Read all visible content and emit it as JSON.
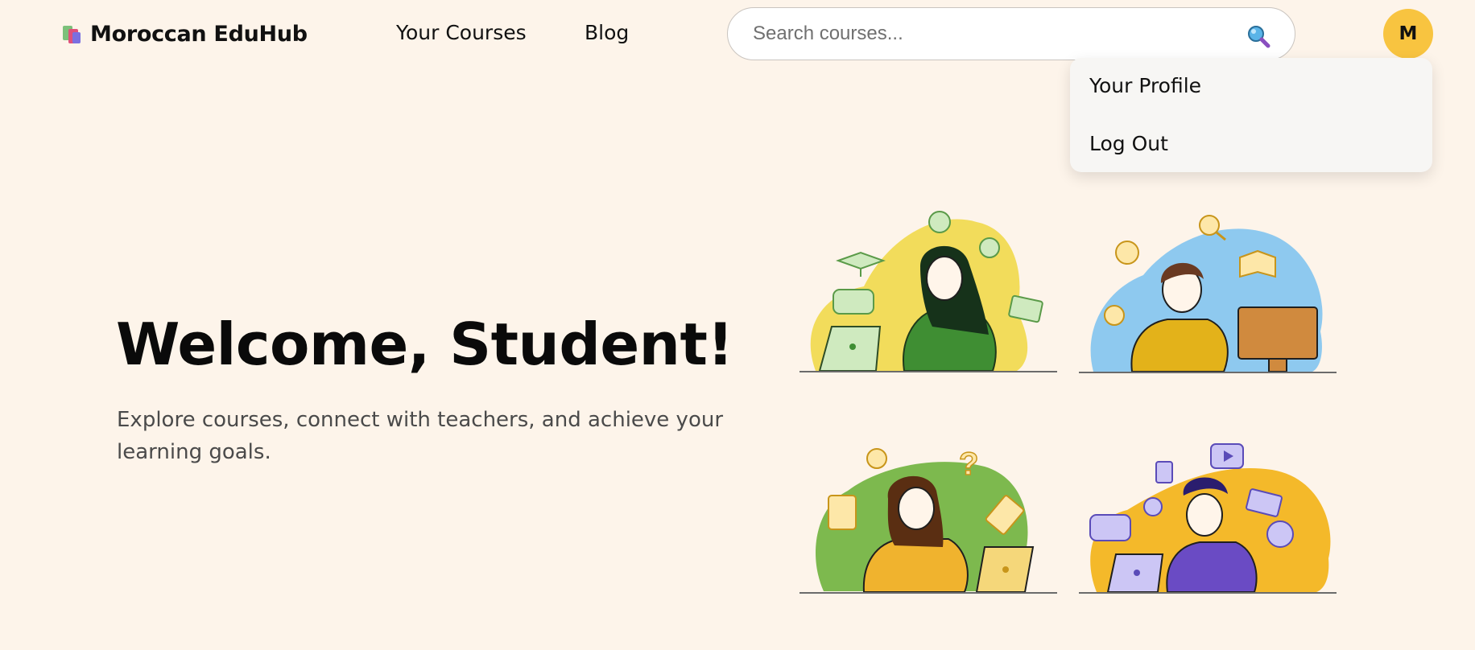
{
  "header": {
    "logo_text": "Moroccan EduHub",
    "nav": [
      "Your Courses",
      "Blog"
    ],
    "search_placeholder": "Search courses...",
    "avatar_initial": "M"
  },
  "dropdown": {
    "items": [
      "Your Profile",
      "Log Out"
    ]
  },
  "hero": {
    "title": "Welcome, Student!",
    "subtitle": "Explore courses, connect with teachers, and achieve your learning goals."
  },
  "illustrations": [
    {
      "icon": "student-laptop-thinking-illustration",
      "blob_color": "#f2dc5b"
    },
    {
      "icon": "student-desktop-writing-illustration",
      "blob_color": "#8ec9ef"
    },
    {
      "icon": "student-laptop-pencil-illustration",
      "blob_color": "#7db94e"
    },
    {
      "icon": "student-laptop-social-illustration",
      "blob_color": "#f4b92a"
    }
  ],
  "colors": {
    "background": "#fdf4ea",
    "avatar": "#f8c440",
    "dropdown": "#f7f6f4"
  }
}
